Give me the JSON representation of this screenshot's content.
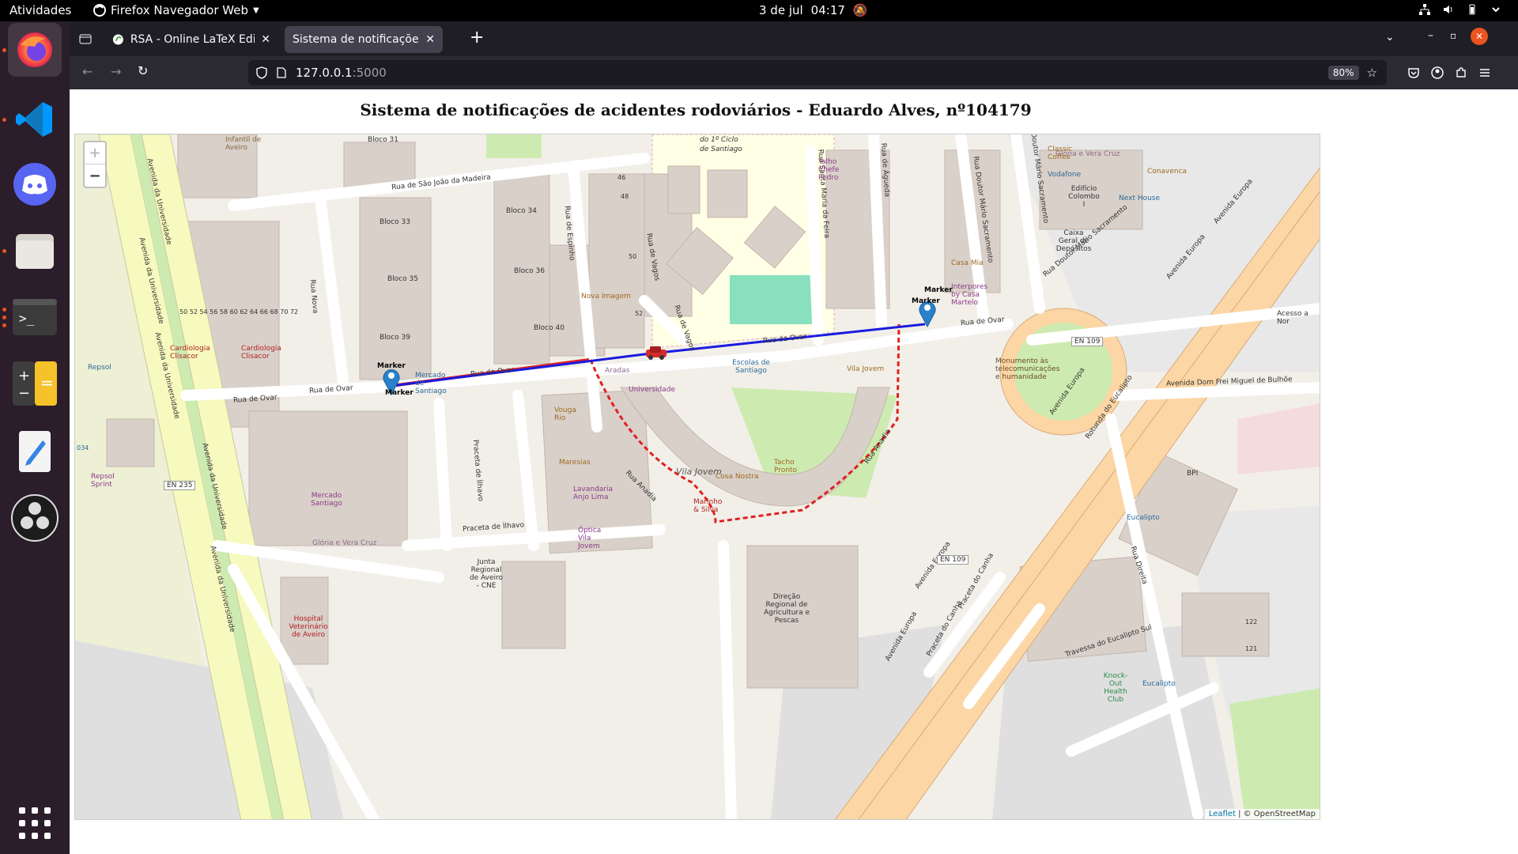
{
  "topbar": {
    "activities": "Atividades",
    "app_name": "Firefox Navegador Web",
    "date": "3 de jul",
    "time": "04:17"
  },
  "dock": {
    "items": [
      {
        "name": "firefox",
        "icon": "firefox-icon"
      },
      {
        "name": "vscode",
        "icon": "vscode-icon"
      },
      {
        "name": "discord",
        "icon": "discord-icon"
      },
      {
        "name": "files",
        "icon": "files-icon"
      },
      {
        "name": "terminal",
        "icon": "terminal-icon"
      },
      {
        "name": "calculator",
        "icon": "calculator-icon"
      },
      {
        "name": "text-editor",
        "icon": "text-editor-icon"
      },
      {
        "name": "obs",
        "icon": "obs-icon"
      },
      {
        "name": "apps",
        "icon": "app-grid-icon"
      }
    ]
  },
  "browser": {
    "tabs": [
      {
        "label": "RSA - Online LaTeX Edito",
        "active": false
      },
      {
        "label": "Sistema de notificações de a",
        "active": true
      }
    ],
    "url_host": "127.0.0.1",
    "url_port": ":5000",
    "zoom": "80%"
  },
  "page": {
    "title": "Sistema de notificações de acidentes rodoviários - Eduardo Alves, nº104179"
  },
  "map": {
    "zoom_in": "+",
    "zoom_out": "−",
    "attribution_leaflet": "Leaflet",
    "attribution_rest": " | © OpenStreetMap",
    "markers": [
      {
        "label": "Marker",
        "id": "start"
      },
      {
        "label": "Marker",
        "id": "end"
      }
    ],
    "labels": {
      "rua_ovar_1": "Rua de Ovar",
      "rua_ovar_2": "Rua de Ovar",
      "rua_ovar_3": "Rua de Ovar",
      "rua_ovar_4": "Rua de Ovar",
      "rua_ovar_5": "Rua de Ovar",
      "rua_sao_joao": "Rua de São João da Madeira",
      "rua_nova": "Rua Nova",
      "rua_espinho": "Rua de Espinho",
      "rua_vagos": "Rua de Vagos",
      "rua_vagos2": "Rua de Vagos",
      "rua_feira": "Rua Santa Maria da Feira",
      "rua_agueda": "Rua de Águeda",
      "rua_mario1": "Rua Doutor Mário Sacramento",
      "rua_mario2": "Rua Doutor Mário Sacramento",
      "rua_mario3": "Rua Doutor Mário Sacramento",
      "rua_anadia1": "Rua Anadia",
      "rua_anadia2": "Rua Anadia",
      "av_universidade1": "Avenida da Universidade",
      "av_universidade2": "Avenida da Universidade",
      "av_universidade3": "Avenida da Universidade",
      "av_universidade4": "Avenida da Universidade",
      "av_universidade5": "Avenida da Universidade",
      "av_europa1": "Avenida Europa",
      "av_europa2": "Avenida Europa",
      "av_europa3": "Avenida Europa",
      "av_europa4": "Avenida Europa",
      "av_europa5": "Avenida Europa",
      "av_dom_frei": "Avenida Dom Frei Miguel de Bulhõe",
      "rotunda": "Rotunda do Eucalipto",
      "rua_direita": "Rua Direita",
      "travessa": "Travessa do Eucalipto Sul",
      "praceta_ilhavo1": "Praceta de Ílhavo",
      "praceta_ilhavo2": "Praceta de Ílhavo",
      "praceta_canha1": "Praceta do Canha",
      "praceta_canha2": "Praceta do Canha",
      "vila_jovem": "Vila Jovem",
      "acesso": "Acesso a Nor",
      "en109a": "EN 109",
      "en109b": "EN 109",
      "en235": "EN 235",
      "gloria": "Glória e Vera Cruz",
      "gloria2": "Glória e Vera Cruz",
      "aradas": "Aradas",
      "ciclo": "do 1º Ciclo",
      "santiago": "de Santiago",
      "bloco31": "Bloco 31",
      "bloco33": "Bloco 33",
      "bloco34": "Bloco 34",
      "bloco35": "Bloco 35",
      "bloco36": "Bloco 36",
      "bloco39": "Bloco 39",
      "bloco40": "Bloco 40",
      "universidade": "Universidade",
      "escolas": "Escolas de Santiago",
      "mercado": "Mercado de Santiago",
      "mercado_sant": "Mercado Santiago",
      "nova_imagem": "Nova Imagem",
      "vouga_rio": "Vouga Rio",
      "maresias": "Maresias",
      "lavandaria": "Lavandaria Anjo Lima",
      "optica": "Óptica Vila Jovem",
      "cosa_nostra": "Cosa Nostra",
      "marinho": "Marinho & Silva",
      "tacho": "Tacho Pronto",
      "vila_jovem_poi": "Vila Jovem",
      "junta": "Junta Regional de Aveiro - CNE",
      "direcao": "Direção Regional de Agricultura e Pescas",
      "hospital": "Hospital Veterinário de Aveiro",
      "cardiologia1": "Cardiologia Clisacor",
      "cardiologia2": "Cardiologia Clisacor",
      "repsol": "Repsol",
      "repsol_sprint": "Repsol Sprint",
      "talho": "Talho Chefe Pedro",
      "vodafone": "Vodafone",
      "classic": "Classic Coffee",
      "conavenca": "Conavenca",
      "colombo": "Edifício Colombo I",
      "nexthouse": "Next House",
      "caixa": "Caixa Geral de Depósitos",
      "casa_mia": "Casa Mia",
      "interpores": "Interpores by Casa Martelo",
      "monumento": "Monumento às telecomunicações e humanidade",
      "bpi": "BPI",
      "eucalipto1": "Eucalipto",
      "eucalipto2": "Eucalipto",
      "knockout": "Knock-Out Health Club",
      "house_nums": "50 52 54 56 58 60 62 64 66 68 70 72",
      "num46": "46",
      "num48": "48",
      "num50": "50",
      "num52": "52",
      "num122": "122",
      "num121": "121",
      "num034": "034",
      "infantil": "Infantil de Aveiro"
    }
  },
  "colors": {
    "route_blue": "#1a1adf",
    "route_red_dashed": "#e02020",
    "building": "#d9d0c9",
    "park": "#c8facc",
    "school": "#ffffe5",
    "trunk_road": "#f9b29c",
    "primary_road": "#fcd6a4",
    "secondary_road": "#f7fabf"
  }
}
